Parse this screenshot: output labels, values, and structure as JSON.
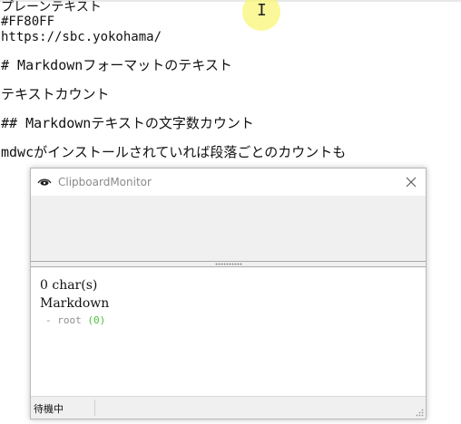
{
  "editor": {
    "lines": [
      "プレーンテキスト",
      "#FF80FF",
      "https://sbc.yokohama/",
      "# Markdownフォーマットのテキスト",
      "テキストカウント",
      "## Markdownテキストの文字数カウント",
      "mdwcがインストールされていれば段落ごとのカウントも"
    ]
  },
  "window": {
    "title": "ClipboardMonitor",
    "char_count": "0 char(s)",
    "markdown_heading": "Markdown",
    "tree_root_label": "- root",
    "tree_root_count": "(0)",
    "status": "待機中"
  },
  "icons": {
    "app": "eye-icon",
    "close": "close-icon",
    "cursor": "text-cursor-icon",
    "grip": "resize-grip-icon"
  },
  "colors": {
    "cursor_highlight": "#faf578",
    "tree_count": "#4cbf3a",
    "tree_label": "#8f8f8f"
  }
}
